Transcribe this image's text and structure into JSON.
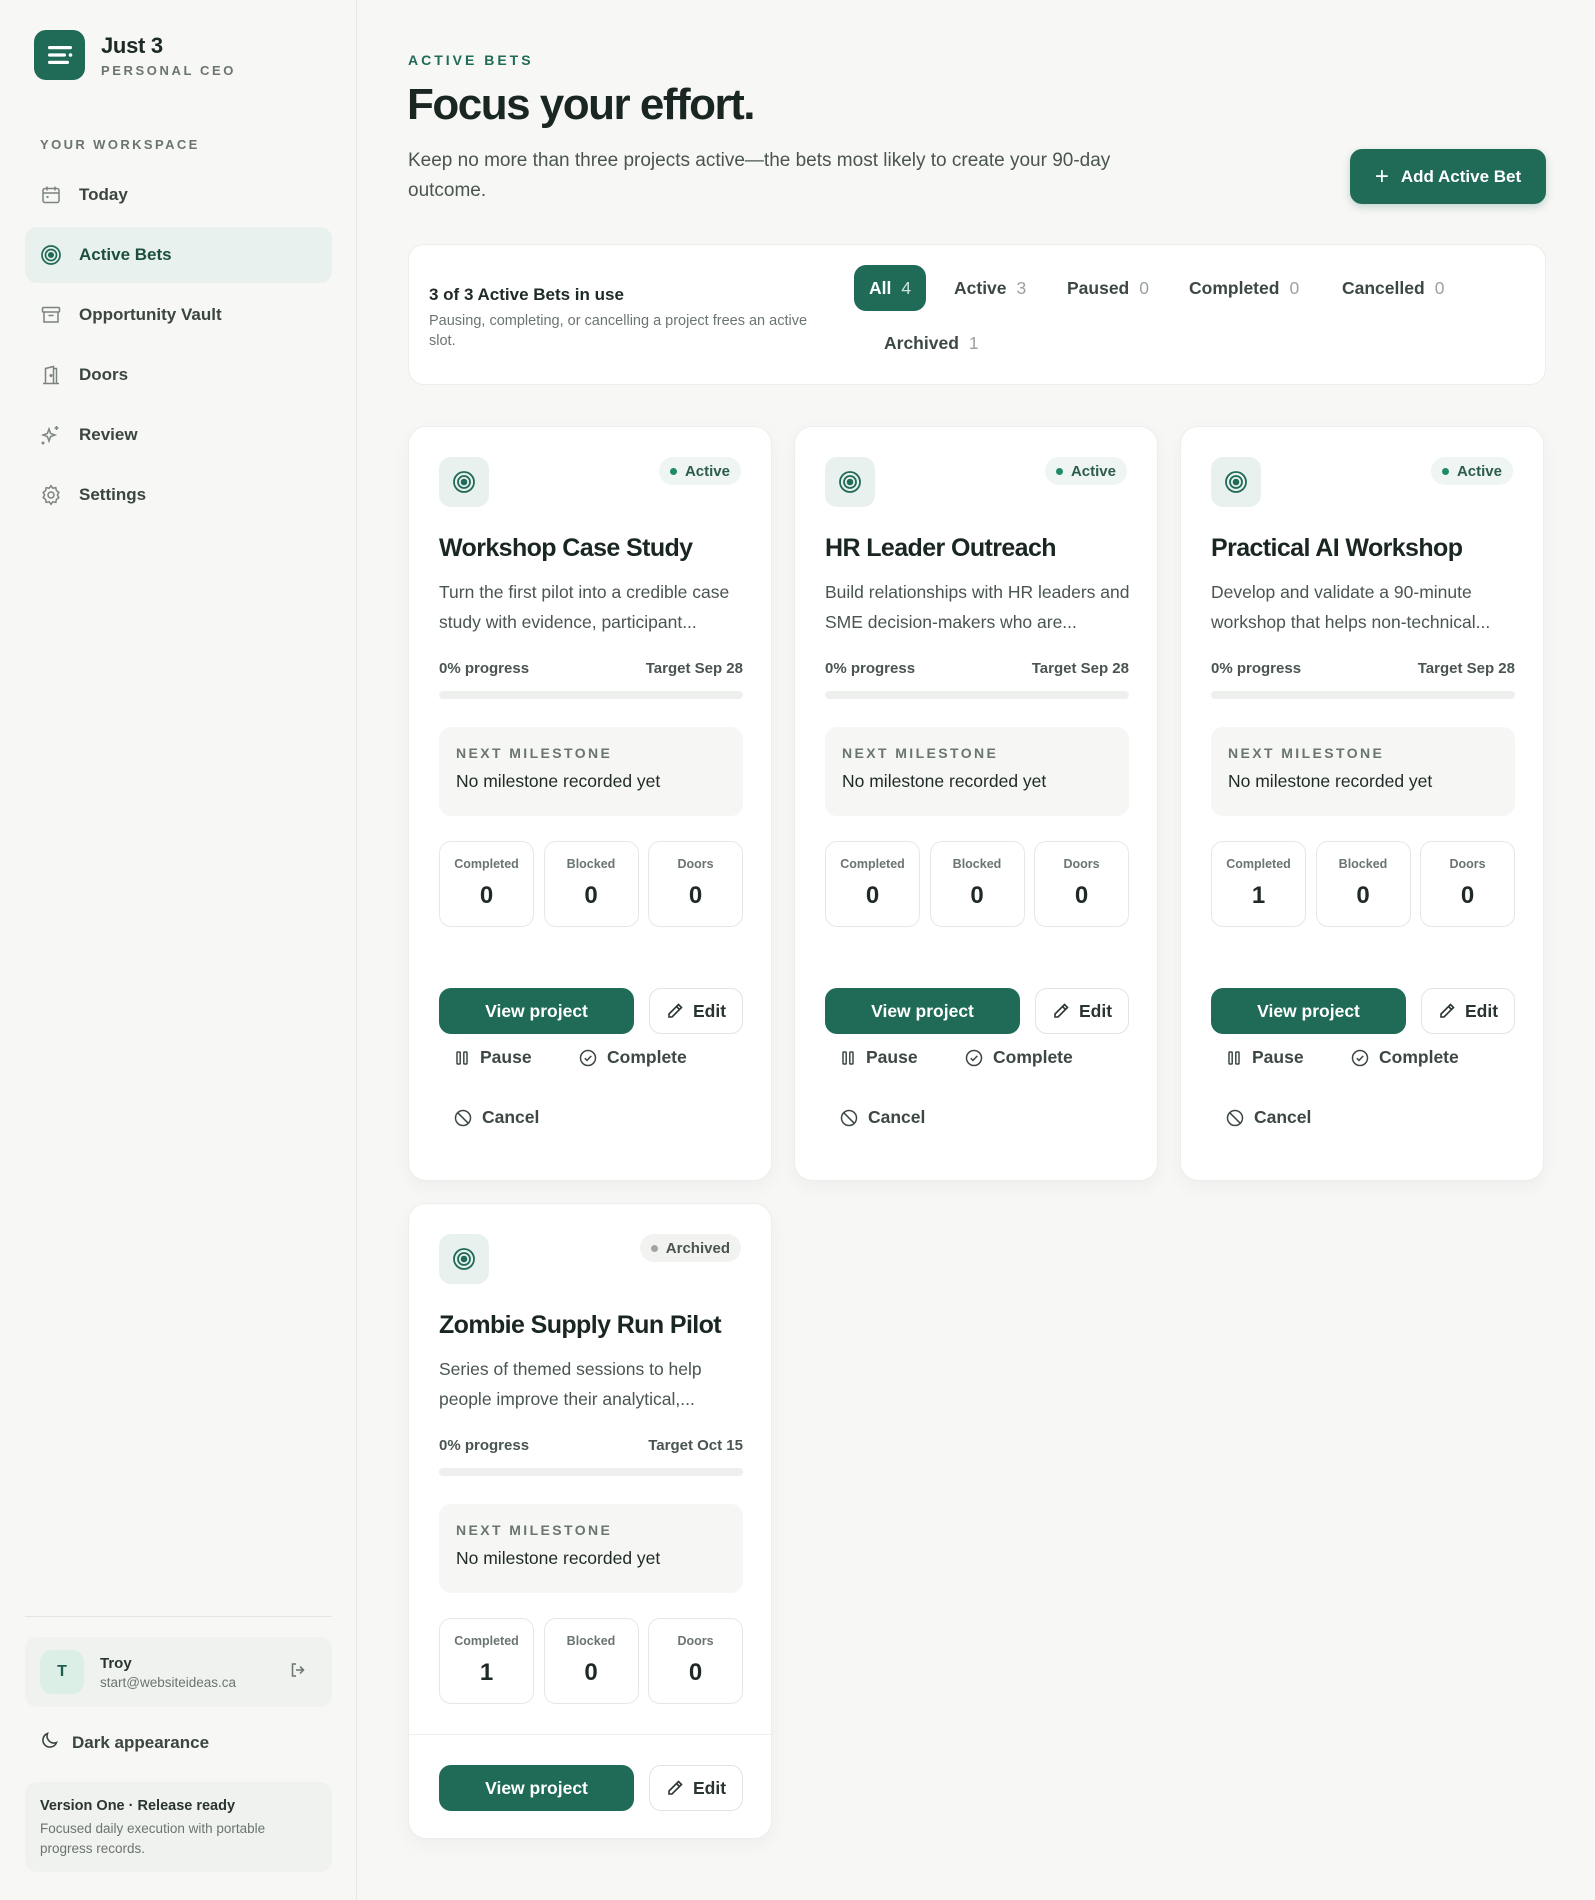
{
  "brand": {
    "name": "Just 3",
    "subtitle": "PERSONAL CEO"
  },
  "sidebar": {
    "section_label": "YOUR WORKSPACE",
    "items": [
      {
        "label": "Today",
        "icon": "calendar-icon"
      },
      {
        "label": "Active Bets",
        "icon": "target-icon",
        "active": true
      },
      {
        "label": "Opportunity Vault",
        "icon": "archive-box-icon"
      },
      {
        "label": "Doors",
        "icon": "door-icon"
      },
      {
        "label": "Review",
        "icon": "sparkle-icon"
      },
      {
        "label": "Settings",
        "icon": "gear-icon"
      }
    ],
    "user": {
      "initial": "T",
      "name": "Troy",
      "email": "start@websiteideas.ca"
    },
    "dark_toggle": "Dark appearance",
    "version": {
      "title": "Version One · Release ready",
      "description": "Focused daily execution with portable progress records."
    }
  },
  "header": {
    "eyebrow": "ACTIVE BETS",
    "title": "Focus your effort.",
    "description": "Keep no more than three projects active—the bets most likely to create your 90-day outcome.",
    "add_button": "Add Active Bet"
  },
  "summary": {
    "title": "3 of 3 Active Bets in use",
    "description": "Pausing, completing, or cancelling a project frees an active slot.",
    "filters": [
      {
        "label": "All",
        "count": "4",
        "active": true
      },
      {
        "label": "Active",
        "count": "3"
      },
      {
        "label": "Paused",
        "count": "0"
      },
      {
        "label": "Completed",
        "count": "0"
      },
      {
        "label": "Cancelled",
        "count": "0"
      },
      {
        "label": "Archived",
        "count": "1"
      }
    ]
  },
  "labels": {
    "next_milestone": "NEXT MILESTONE",
    "completed": "Completed",
    "blocked": "Blocked",
    "doors": "Doors",
    "view_project": "View project",
    "edit": "Edit",
    "pause": "Pause",
    "complete": "Complete",
    "cancel": "Cancel"
  },
  "cards": [
    {
      "status": "Active",
      "title": "Workshop Case Study",
      "description": "Turn the first pilot into a credible case study with evidence, participant...",
      "progress_label": "0% progress",
      "progress": 0,
      "target": "Target Sep 28",
      "milestone": "No milestone recorded yet",
      "completed": "0",
      "blocked": "0",
      "doors": "0"
    },
    {
      "status": "Active",
      "title": "HR Leader Outreach",
      "description": "Build relationships with HR leaders and SME decision-makers who are...",
      "progress_label": "0% progress",
      "progress": 0,
      "target": "Target Sep 28",
      "milestone": "No milestone recorded yet",
      "completed": "0",
      "blocked": "0",
      "doors": "0"
    },
    {
      "status": "Active",
      "title": "Practical AI Workshop",
      "description": "Develop and validate a 90-minute workshop that helps non-technical...",
      "progress_label": "0% progress",
      "progress": 0,
      "target": "Target Sep 28",
      "milestone": "No milestone recorded yet",
      "completed": "1",
      "blocked": "0",
      "doors": "0"
    },
    {
      "status": "Archived",
      "title": "Zombie Supply Run Pilot",
      "description": "Series of themed sessions to help people improve their analytical,...",
      "progress_label": "0% progress",
      "progress": 0,
      "target": "Target Oct 15",
      "milestone": "No milestone recorded yet",
      "completed": "1",
      "blocked": "0",
      "doors": "0"
    }
  ],
  "colors": {
    "accent": "#1f6b57",
    "accent_soft": "#e9f1ee",
    "background": "#f7f7f5"
  }
}
